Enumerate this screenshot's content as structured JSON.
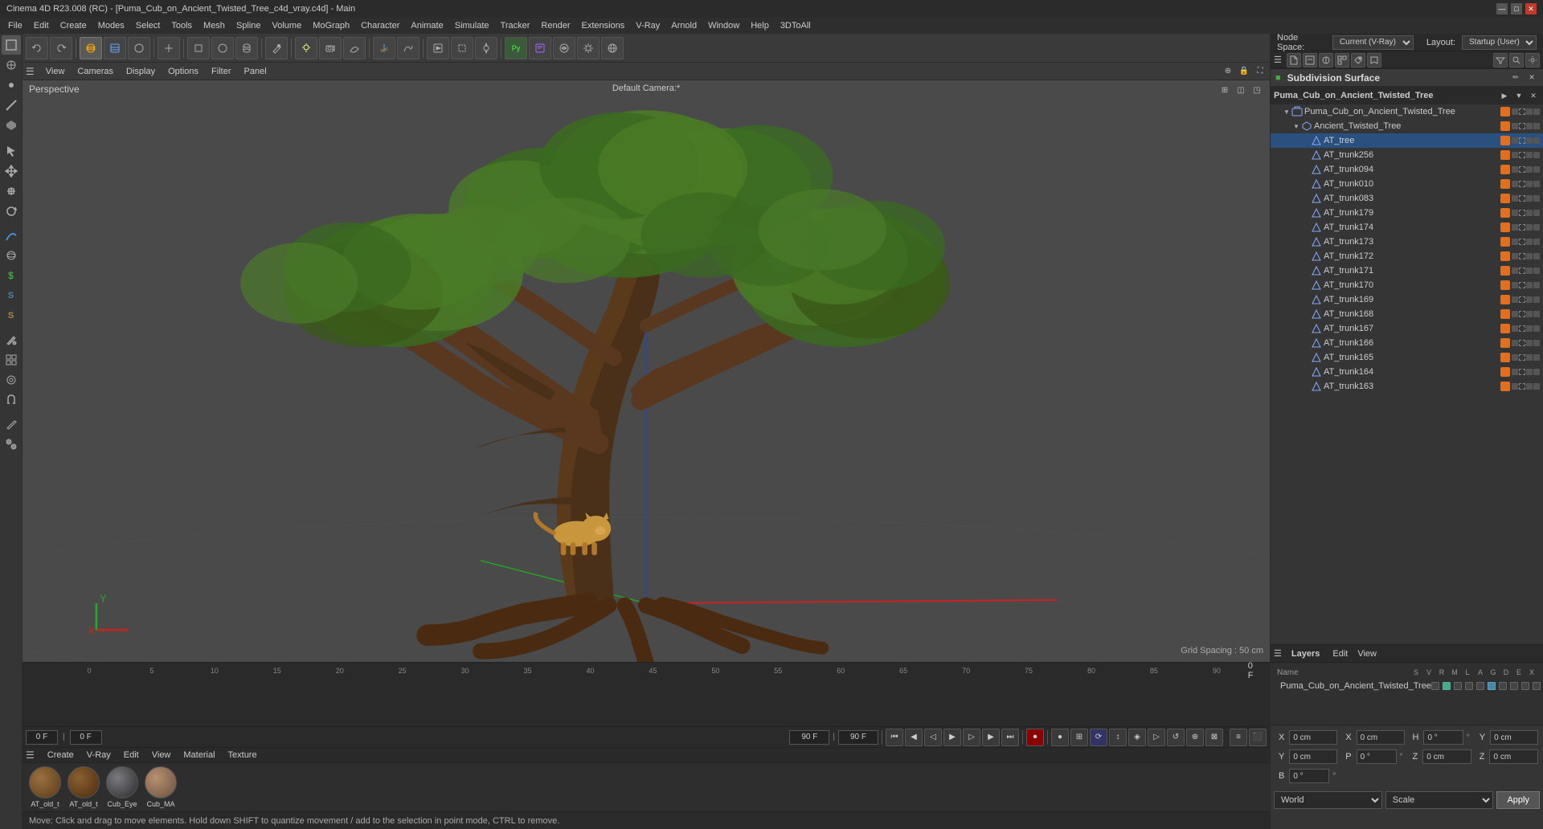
{
  "titlebar": {
    "title": "Cinema 4D R23.008 (RC) - [Puma_Cub_on_Ancient_Twisted_Tree_c4d_vray.c4d] - Main",
    "minimize": "—",
    "maximize": "□",
    "close": "✕"
  },
  "menu": {
    "items": [
      "File",
      "Edit",
      "Create",
      "Modes",
      "Select",
      "Tools",
      "Mesh",
      "Spline",
      "Volume",
      "MoGraph",
      "Character",
      "Animate",
      "Simulate",
      "Tracker",
      "Render",
      "Extensions",
      "V-Ray",
      "Arnold",
      "Window",
      "Help",
      "3DToAll"
    ]
  },
  "viewport": {
    "label": "Perspective",
    "camera": "Default Camera:*",
    "grid_spacing": "Grid Spacing : 50 cm",
    "toolbar": [
      "View",
      "Cameras",
      "Display",
      "Options",
      "Filter",
      "Panel"
    ]
  },
  "node_space": {
    "label": "Node Space:",
    "value": "Current (V-Ray)",
    "layout_label": "Layout:",
    "layout_value": "Startup (User)"
  },
  "subdivision": {
    "title": "Subdivision Surface"
  },
  "hierarchy": {
    "title": "Puma_Cub_on_Ancient_Twisted_Tree",
    "items": [
      {
        "name": "Puma_Cub_on_Ancient_Twisted_Tree",
        "level": 0,
        "has_arrow": true,
        "type": "root"
      },
      {
        "name": "Ancient_Twisted_Tree",
        "level": 1,
        "has_arrow": true,
        "type": "group"
      },
      {
        "name": "AT_tree",
        "level": 2,
        "has_arrow": false,
        "type": "mesh"
      },
      {
        "name": "AT_trunk256",
        "level": 2,
        "has_arrow": false,
        "type": "mesh"
      },
      {
        "name": "AT_trunk094",
        "level": 2,
        "has_arrow": false,
        "type": "mesh"
      },
      {
        "name": "AT_trunk010",
        "level": 2,
        "has_arrow": false,
        "type": "mesh"
      },
      {
        "name": "AT_trunk083",
        "level": 2,
        "has_arrow": false,
        "type": "mesh"
      },
      {
        "name": "AT_trunk179",
        "level": 2,
        "has_arrow": false,
        "type": "mesh"
      },
      {
        "name": "AT_trunk174",
        "level": 2,
        "has_arrow": false,
        "type": "mesh"
      },
      {
        "name": "AT_trunk173",
        "level": 2,
        "has_arrow": false,
        "type": "mesh"
      },
      {
        "name": "AT_trunk172",
        "level": 2,
        "has_arrow": false,
        "type": "mesh"
      },
      {
        "name": "AT_trunk171",
        "level": 2,
        "has_arrow": false,
        "type": "mesh"
      },
      {
        "name": "AT_trunk170",
        "level": 2,
        "has_arrow": false,
        "type": "mesh"
      },
      {
        "name": "AT_trunk169",
        "level": 2,
        "has_arrow": false,
        "type": "mesh"
      },
      {
        "name": "AT_trunk168",
        "level": 2,
        "has_arrow": false,
        "type": "mesh"
      },
      {
        "name": "AT_trunk167",
        "level": 2,
        "has_arrow": false,
        "type": "mesh"
      },
      {
        "name": "AT_trunk166",
        "level": 2,
        "has_arrow": false,
        "type": "mesh"
      },
      {
        "name": "AT_trunk165",
        "level": 2,
        "has_arrow": false,
        "type": "mesh"
      },
      {
        "name": "AT_trunk164",
        "level": 2,
        "has_arrow": false,
        "type": "mesh"
      },
      {
        "name": "AT_trunk163",
        "level": 2,
        "has_arrow": false,
        "type": "mesh"
      }
    ]
  },
  "layers": {
    "title": "Layers",
    "menu_items": [
      "Edit",
      "View"
    ],
    "col_headers": [
      "Name",
      "S",
      "V",
      "R",
      "M",
      "L",
      "A",
      "G",
      "D",
      "E",
      "X"
    ],
    "row": {
      "name": "Puma_Cub_on_Ancient_Twisted_Tree",
      "color": "#e07020"
    }
  },
  "coordinates": {
    "x_label": "X",
    "x_pos": "0 cm",
    "x_size_label": "X",
    "x_size": "0 cm",
    "h_label": "H",
    "h_val": "0 °",
    "y_label": "Y",
    "y_pos": "0 cm",
    "y_size_label": "Y",
    "y_size": "0 cm",
    "p_label": "P",
    "p_val": "0 °",
    "z_label": "Z",
    "z_pos": "0 cm",
    "z_size_label": "Z",
    "z_size": "0 cm",
    "b_label": "B",
    "b_val": "0 °",
    "world_dropdown": "World",
    "scale_dropdown": "Scale",
    "apply_btn": "Apply"
  },
  "timeline": {
    "frame_start": "0",
    "frame_end": "90 F",
    "current_frame": "0 F",
    "fps_value": "90 F",
    "fps_display": "90 F",
    "marks": [
      "0",
      "5",
      "10",
      "15",
      "20",
      "25",
      "30",
      "35",
      "40",
      "45",
      "50",
      "55",
      "60",
      "65",
      "70",
      "75",
      "80",
      "85",
      "90"
    ]
  },
  "material_panel": {
    "menu_items": [
      "Create",
      "V-Ray",
      "Edit",
      "View",
      "Material",
      "Texture"
    ],
    "materials": [
      {
        "label": "AT_old_t",
        "color": "#7a5a30"
      },
      {
        "label": "AT_old_t",
        "color": "#6a5028"
      },
      {
        "label": "Cub_Eye",
        "color": "#3a3a3a"
      },
      {
        "label": "Cub_MA",
        "color": "#8a7060"
      }
    ]
  },
  "statusbar": {
    "text": "Move: Click and drag to move elements. Hold down SHIFT to quantize movement / add to the selection in point mode, CTRL to remove."
  }
}
